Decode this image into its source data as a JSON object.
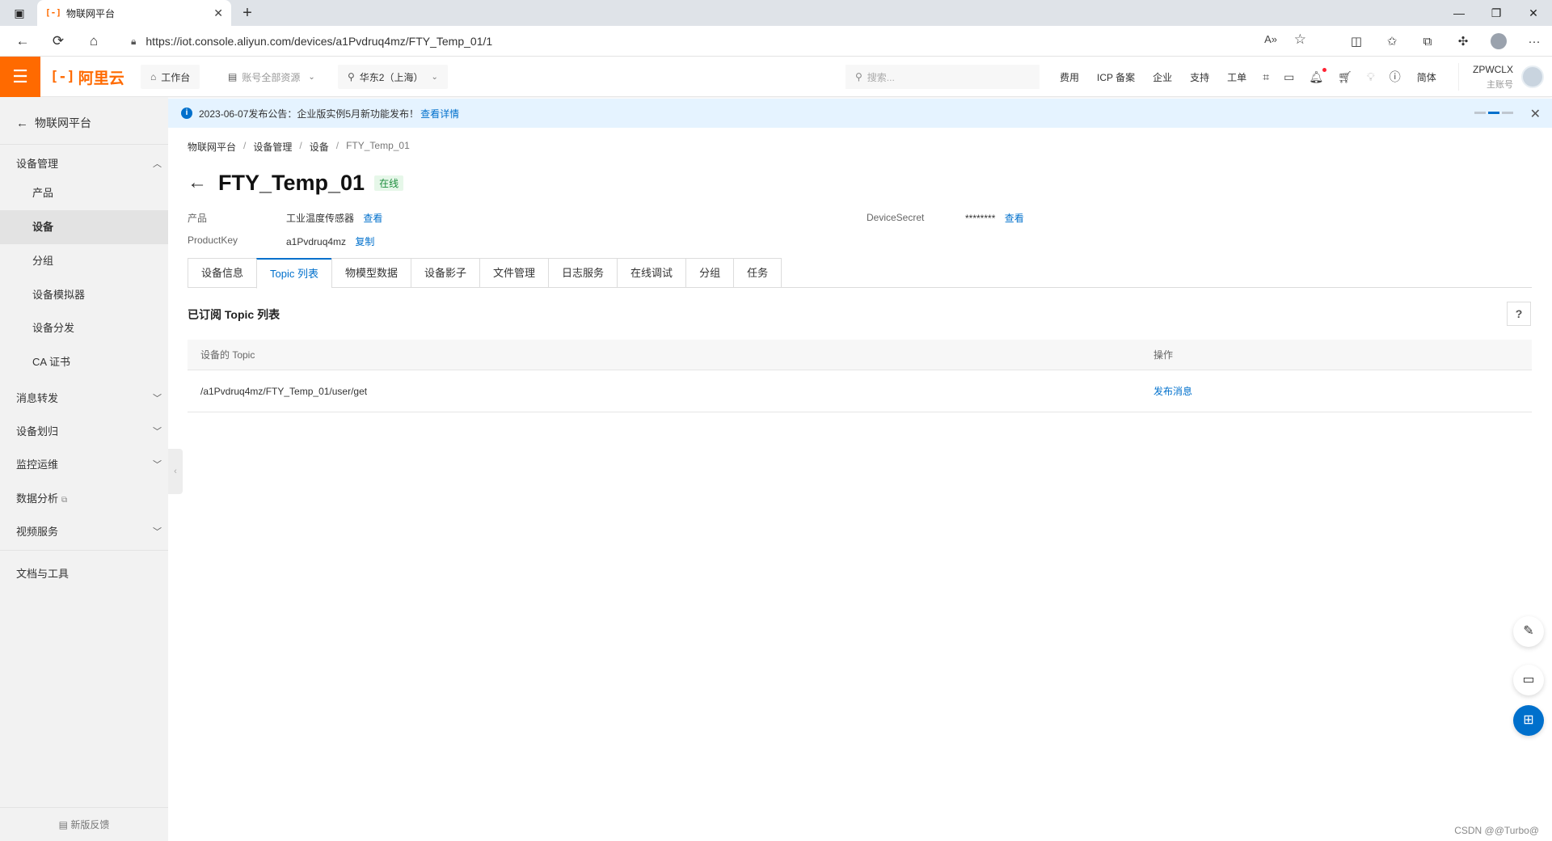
{
  "browser": {
    "tab_title": "物联网平台",
    "url": "https://iot.console.aliyun.com/devices/a1Pvdruq4mz/FTY_Temp_01/1"
  },
  "console_header": {
    "logo_text": "阿里云",
    "workbench": "工作台",
    "account_resources": "账号全部资源",
    "region": "华东2（上海）",
    "search_placeholder": "搜索...",
    "links": [
      "费用",
      "ICP 备案",
      "企业",
      "支持",
      "工单"
    ],
    "lang": "简体",
    "user_name": "ZPWCLX",
    "user_role": "主账号"
  },
  "sidebar": {
    "back_label": "物联网平台",
    "group_device_mgmt": "设备管理",
    "items": [
      "产品",
      "设备",
      "分组",
      "设备模拟器",
      "设备分发",
      "CA 证书"
    ],
    "active_item": "设备",
    "groups": [
      "消息转发",
      "设备划归",
      "监控运维",
      "数据分析",
      "视频服务"
    ],
    "docs_tools": "文档与工具",
    "feedback": "新版反馈"
  },
  "notice": {
    "text": "2023-06-07发布公告：企业版实例5月新功能发布！",
    "link": "查看详情"
  },
  "breadcrumb": [
    "物联网平台",
    "设备管理",
    "设备",
    "FTY_Temp_01"
  ],
  "device": {
    "name": "FTY_Temp_01",
    "status": "在线",
    "product_label": "产品",
    "product_value": "工业温度传感器",
    "product_link": "查看",
    "productkey_label": "ProductKey",
    "productkey_value": "a1Pvdruq4mz",
    "productkey_link": "复制",
    "secret_label": "DeviceSecret",
    "secret_value": "********",
    "secret_link": "查看"
  },
  "tabs": [
    "设备信息",
    "Topic 列表",
    "物模型数据",
    "设备影子",
    "文件管理",
    "日志服务",
    "在线调试",
    "分组",
    "任务"
  ],
  "active_tab": "Topic 列表",
  "topic_section": {
    "title": "已订阅 Topic 列表",
    "help": "?",
    "columns": [
      "设备的 Topic",
      "操作"
    ],
    "rows": [
      {
        "topic": "/a1Pvdruq4mz/FTY_Temp_01/user/get",
        "action": "发布消息"
      }
    ]
  },
  "watermark": "CSDN @@Turbo@",
  "colors": {
    "brand": "#ff6a00",
    "link": "#0070cc",
    "online": "#1e8e3e"
  }
}
